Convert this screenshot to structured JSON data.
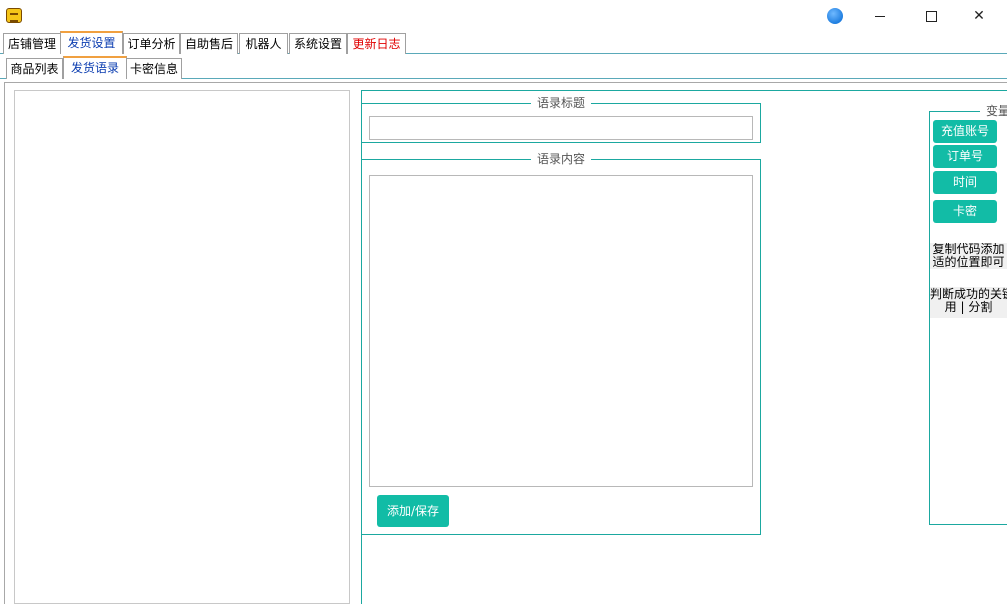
{
  "window": {
    "controls": {
      "minimize": "minimize",
      "maximize": "maximize",
      "close": "close"
    }
  },
  "main_tabs": [
    {
      "label": "店铺管理"
    },
    {
      "label": "发货设置"
    },
    {
      "label": "订单分析"
    },
    {
      "label": "自助售后"
    },
    {
      "label": "机器人"
    },
    {
      "label": "系统设置"
    },
    {
      "label": "更新日志"
    }
  ],
  "sub_tabs": [
    {
      "label": "商品列表"
    },
    {
      "label": "发货语录"
    },
    {
      "label": "卡密信息"
    }
  ],
  "form": {
    "title_group_label": "语录标题",
    "title_value": "",
    "content_group_label": "语录内容",
    "content_value": "",
    "save_label": "添加/保存"
  },
  "variables": {
    "group_label": "变量",
    "buttons": [
      {
        "label": "充值账号"
      },
      {
        "label": "订单号"
      },
      {
        "label": "时间"
      },
      {
        "label": "卡密"
      }
    ],
    "note_copy_line1": "复制代码添加",
    "note_copy_line2": "适的位置即可",
    "note_keyword_line1": "判断成功的关键",
    "note_keyword_line2": "用 | 分割"
  },
  "colors": {
    "accent": "#12bca6",
    "border": "#1ba8a0",
    "active_tab_text": "#0a3cb0",
    "changelog_tab": "#e00000"
  }
}
